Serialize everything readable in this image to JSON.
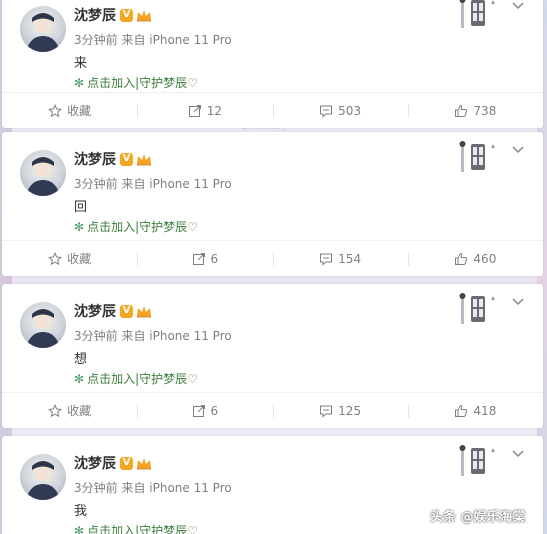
{
  "posts": [
    {
      "author": "沈梦辰",
      "verified_badge": "V",
      "meta": "3分钟前 来自 iPhone 11 Pro",
      "content": "来",
      "promo": "点击加入|守护梦辰♡",
      "actions": {
        "collect": "收藏",
        "repost": "12",
        "comment": "503",
        "like": "738"
      }
    },
    {
      "author": "沈梦辰",
      "verified_badge": "V",
      "meta": "3分钟前 来自 iPhone 11 Pro",
      "content": "回",
      "promo": "点击加入|守护梦辰♡",
      "actions": {
        "collect": "收藏",
        "repost": "6",
        "comment": "154",
        "like": "460"
      }
    },
    {
      "author": "沈梦辰",
      "verified_badge": "V",
      "meta": "3分钟前 来自 iPhone 11 Pro",
      "content": "想",
      "promo": "点击加入|守护梦辰♡",
      "actions": {
        "collect": "收藏",
        "repost": "6",
        "comment": "125",
        "like": "418"
      }
    },
    {
      "author": "沈梦辰",
      "verified_badge": "V",
      "meta": "3分钟前 来自 iPhone 11 Pro",
      "content": "我",
      "promo": "点击加入|守护梦辰♡"
    }
  ],
  "background_text": "Birthday",
  "watermark": "头条 @娱乐海棠",
  "colors": {
    "badge": "#f5a623",
    "promo_text": "#3a7d3a",
    "muted": "#808080"
  },
  "icons": {
    "collect": "star-icon",
    "repost": "share-icon",
    "comment": "comment-icon",
    "like": "thumbs-up-icon"
  }
}
